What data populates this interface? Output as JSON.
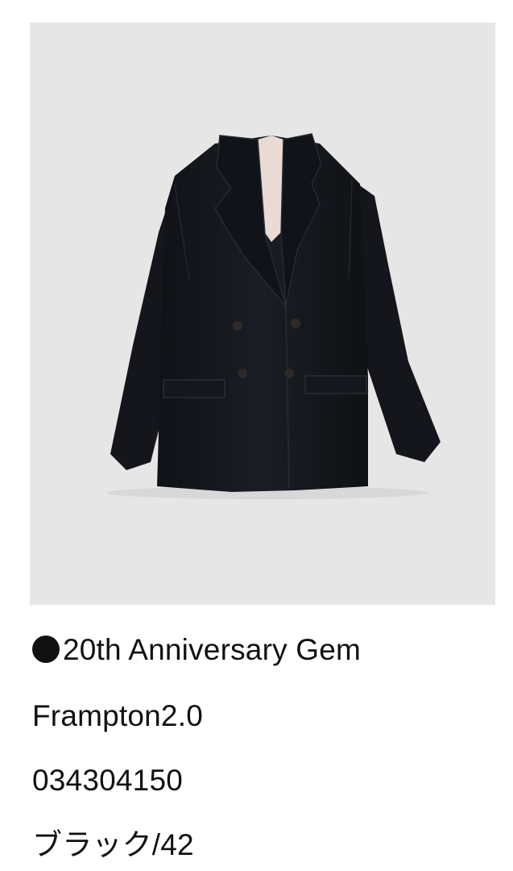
{
  "product": {
    "image_alt": "jacket-photo",
    "tag_icon": "filled-circle-icon",
    "tag_label": "20th Anniversary Gem",
    "model_name": "Frampton2.0",
    "product_code": "034304150",
    "color_size": "ブラック/42"
  },
  "colors": {
    "image_background": "#e6e6e7",
    "jacket": "#15171c",
    "lining": "#e9dad4",
    "text": "#111111"
  }
}
